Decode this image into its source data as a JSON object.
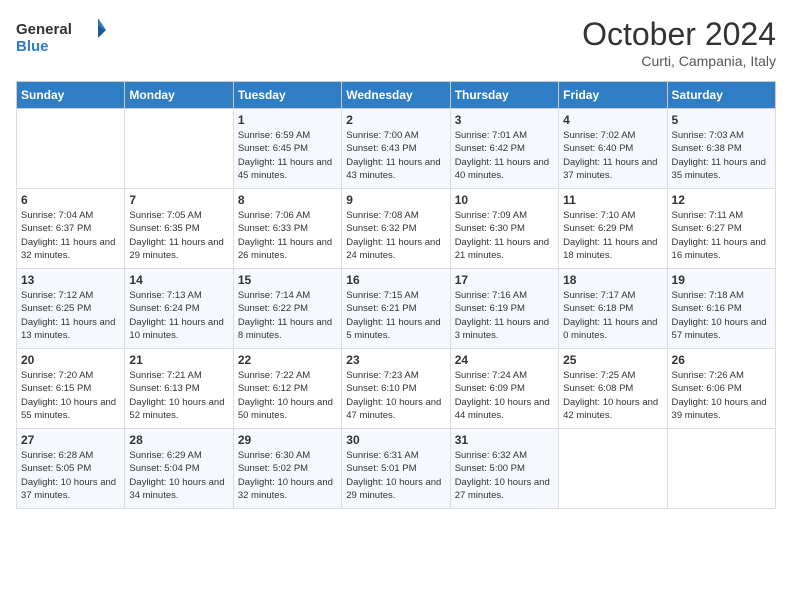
{
  "logo": {
    "line1": "General",
    "line2": "Blue"
  },
  "title": "October 2024",
  "subtitle": "Curti, Campania, Italy",
  "days_header": [
    "Sunday",
    "Monday",
    "Tuesday",
    "Wednesday",
    "Thursday",
    "Friday",
    "Saturday"
  ],
  "weeks": [
    [
      {
        "day": "",
        "sunrise": "",
        "sunset": "",
        "daylight": ""
      },
      {
        "day": "",
        "sunrise": "",
        "sunset": "",
        "daylight": ""
      },
      {
        "day": "1",
        "sunrise": "Sunrise: 6:59 AM",
        "sunset": "Sunset: 6:45 PM",
        "daylight": "Daylight: 11 hours and 45 minutes."
      },
      {
        "day": "2",
        "sunrise": "Sunrise: 7:00 AM",
        "sunset": "Sunset: 6:43 PM",
        "daylight": "Daylight: 11 hours and 43 minutes."
      },
      {
        "day": "3",
        "sunrise": "Sunrise: 7:01 AM",
        "sunset": "Sunset: 6:42 PM",
        "daylight": "Daylight: 11 hours and 40 minutes."
      },
      {
        "day": "4",
        "sunrise": "Sunrise: 7:02 AM",
        "sunset": "Sunset: 6:40 PM",
        "daylight": "Daylight: 11 hours and 37 minutes."
      },
      {
        "day": "5",
        "sunrise": "Sunrise: 7:03 AM",
        "sunset": "Sunset: 6:38 PM",
        "daylight": "Daylight: 11 hours and 35 minutes."
      }
    ],
    [
      {
        "day": "6",
        "sunrise": "Sunrise: 7:04 AM",
        "sunset": "Sunset: 6:37 PM",
        "daylight": "Daylight: 11 hours and 32 minutes."
      },
      {
        "day": "7",
        "sunrise": "Sunrise: 7:05 AM",
        "sunset": "Sunset: 6:35 PM",
        "daylight": "Daylight: 11 hours and 29 minutes."
      },
      {
        "day": "8",
        "sunrise": "Sunrise: 7:06 AM",
        "sunset": "Sunset: 6:33 PM",
        "daylight": "Daylight: 11 hours and 26 minutes."
      },
      {
        "day": "9",
        "sunrise": "Sunrise: 7:08 AM",
        "sunset": "Sunset: 6:32 PM",
        "daylight": "Daylight: 11 hours and 24 minutes."
      },
      {
        "day": "10",
        "sunrise": "Sunrise: 7:09 AM",
        "sunset": "Sunset: 6:30 PM",
        "daylight": "Daylight: 11 hours and 21 minutes."
      },
      {
        "day": "11",
        "sunrise": "Sunrise: 7:10 AM",
        "sunset": "Sunset: 6:29 PM",
        "daylight": "Daylight: 11 hours and 18 minutes."
      },
      {
        "day": "12",
        "sunrise": "Sunrise: 7:11 AM",
        "sunset": "Sunset: 6:27 PM",
        "daylight": "Daylight: 11 hours and 16 minutes."
      }
    ],
    [
      {
        "day": "13",
        "sunrise": "Sunrise: 7:12 AM",
        "sunset": "Sunset: 6:25 PM",
        "daylight": "Daylight: 11 hours and 13 minutes."
      },
      {
        "day": "14",
        "sunrise": "Sunrise: 7:13 AM",
        "sunset": "Sunset: 6:24 PM",
        "daylight": "Daylight: 11 hours and 10 minutes."
      },
      {
        "day": "15",
        "sunrise": "Sunrise: 7:14 AM",
        "sunset": "Sunset: 6:22 PM",
        "daylight": "Daylight: 11 hours and 8 minutes."
      },
      {
        "day": "16",
        "sunrise": "Sunrise: 7:15 AM",
        "sunset": "Sunset: 6:21 PM",
        "daylight": "Daylight: 11 hours and 5 minutes."
      },
      {
        "day": "17",
        "sunrise": "Sunrise: 7:16 AM",
        "sunset": "Sunset: 6:19 PM",
        "daylight": "Daylight: 11 hours and 3 minutes."
      },
      {
        "day": "18",
        "sunrise": "Sunrise: 7:17 AM",
        "sunset": "Sunset: 6:18 PM",
        "daylight": "Daylight: 11 hours and 0 minutes."
      },
      {
        "day": "19",
        "sunrise": "Sunrise: 7:18 AM",
        "sunset": "Sunset: 6:16 PM",
        "daylight": "Daylight: 10 hours and 57 minutes."
      }
    ],
    [
      {
        "day": "20",
        "sunrise": "Sunrise: 7:20 AM",
        "sunset": "Sunset: 6:15 PM",
        "daylight": "Daylight: 10 hours and 55 minutes."
      },
      {
        "day": "21",
        "sunrise": "Sunrise: 7:21 AM",
        "sunset": "Sunset: 6:13 PM",
        "daylight": "Daylight: 10 hours and 52 minutes."
      },
      {
        "day": "22",
        "sunrise": "Sunrise: 7:22 AM",
        "sunset": "Sunset: 6:12 PM",
        "daylight": "Daylight: 10 hours and 50 minutes."
      },
      {
        "day": "23",
        "sunrise": "Sunrise: 7:23 AM",
        "sunset": "Sunset: 6:10 PM",
        "daylight": "Daylight: 10 hours and 47 minutes."
      },
      {
        "day": "24",
        "sunrise": "Sunrise: 7:24 AM",
        "sunset": "Sunset: 6:09 PM",
        "daylight": "Daylight: 10 hours and 44 minutes."
      },
      {
        "day": "25",
        "sunrise": "Sunrise: 7:25 AM",
        "sunset": "Sunset: 6:08 PM",
        "daylight": "Daylight: 10 hours and 42 minutes."
      },
      {
        "day": "26",
        "sunrise": "Sunrise: 7:26 AM",
        "sunset": "Sunset: 6:06 PM",
        "daylight": "Daylight: 10 hours and 39 minutes."
      }
    ],
    [
      {
        "day": "27",
        "sunrise": "Sunrise: 6:28 AM",
        "sunset": "Sunset: 5:05 PM",
        "daylight": "Daylight: 10 hours and 37 minutes."
      },
      {
        "day": "28",
        "sunrise": "Sunrise: 6:29 AM",
        "sunset": "Sunset: 5:04 PM",
        "daylight": "Daylight: 10 hours and 34 minutes."
      },
      {
        "day": "29",
        "sunrise": "Sunrise: 6:30 AM",
        "sunset": "Sunset: 5:02 PM",
        "daylight": "Daylight: 10 hours and 32 minutes."
      },
      {
        "day": "30",
        "sunrise": "Sunrise: 6:31 AM",
        "sunset": "Sunset: 5:01 PM",
        "daylight": "Daylight: 10 hours and 29 minutes."
      },
      {
        "day": "31",
        "sunrise": "Sunrise: 6:32 AM",
        "sunset": "Sunset: 5:00 PM",
        "daylight": "Daylight: 10 hours and 27 minutes."
      },
      {
        "day": "",
        "sunrise": "",
        "sunset": "",
        "daylight": ""
      },
      {
        "day": "",
        "sunrise": "",
        "sunset": "",
        "daylight": ""
      }
    ]
  ]
}
